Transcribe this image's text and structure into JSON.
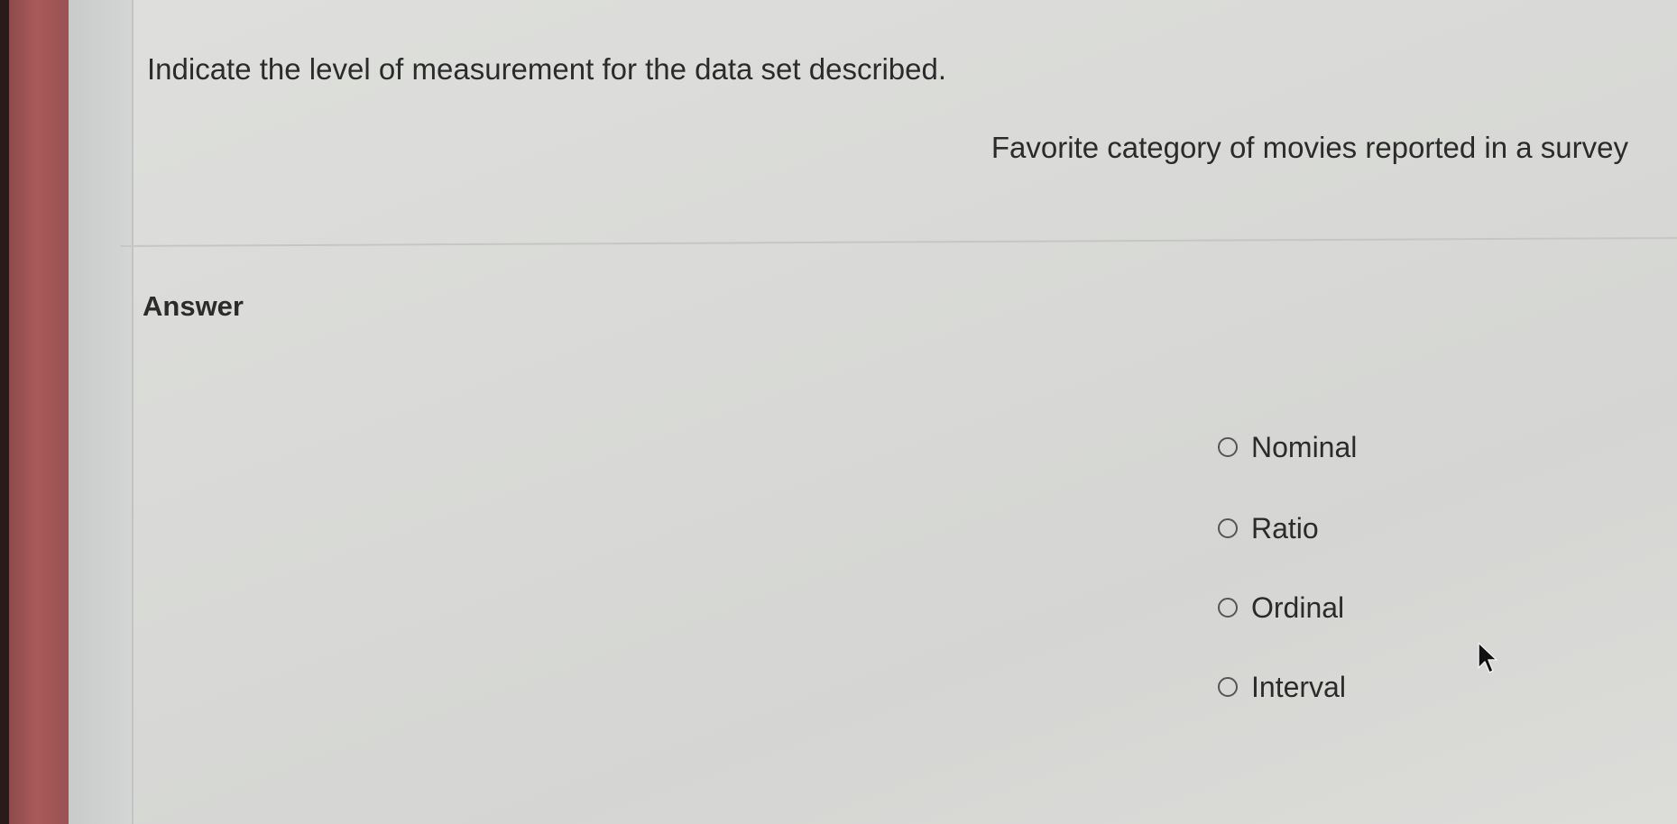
{
  "question": {
    "title": "Indicate the level of measurement for the data set described.",
    "description": "Favorite category of movies reported in a survey"
  },
  "answer": {
    "label": "Answer",
    "options": [
      {
        "label": "Nominal",
        "selected": false
      },
      {
        "label": "Ratio",
        "selected": false
      },
      {
        "label": "Ordinal",
        "selected": false
      },
      {
        "label": "Interval",
        "selected": false
      }
    ]
  },
  "icons": {
    "radio": "radio-empty-icon",
    "cursor": "mouse-pointer-icon"
  },
  "colors": {
    "background": "#d8d9d6",
    "text": "#2b2b2b",
    "bezel": "#a85a5a"
  }
}
